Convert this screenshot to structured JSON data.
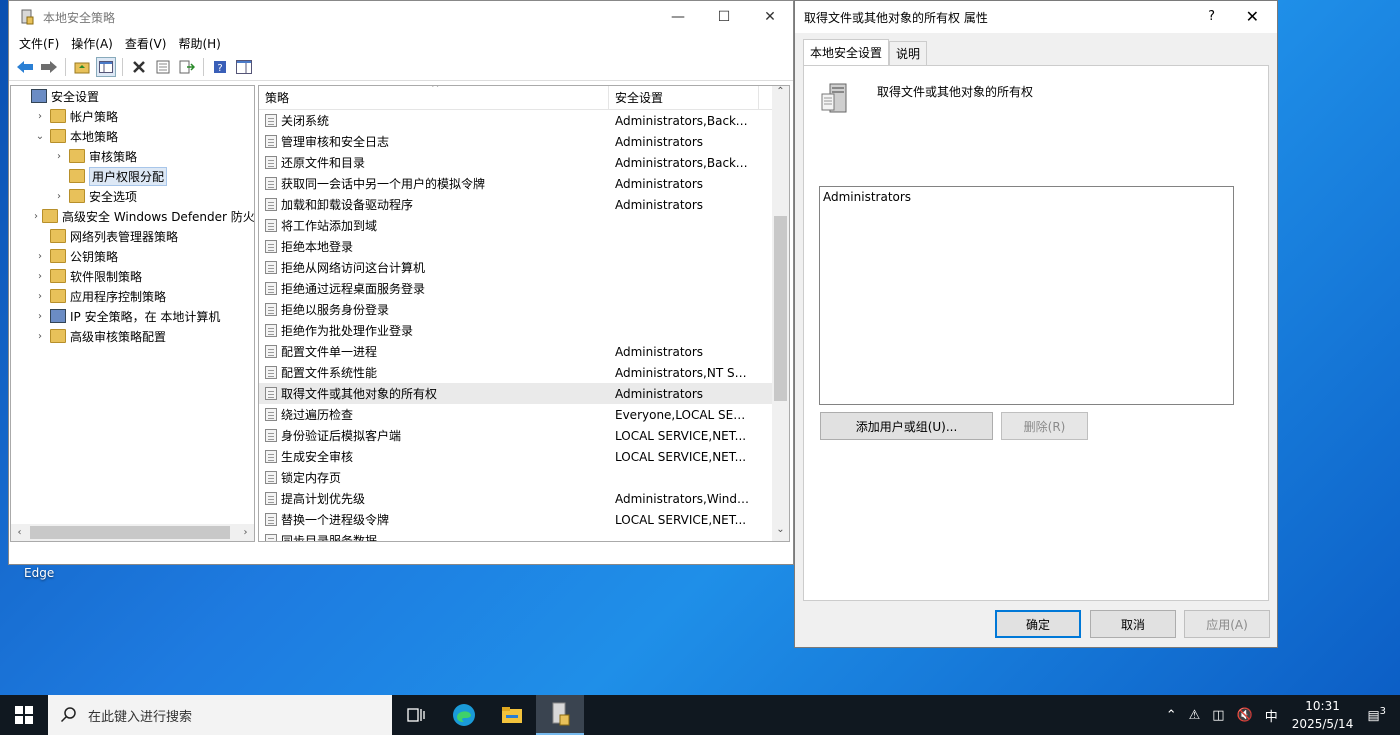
{
  "mmc": {
    "title": "本地安全策略",
    "menu": [
      "文件(F)",
      "操作(A)",
      "查看(V)",
      "帮助(H)"
    ],
    "tree": [
      {
        "label": "安全设置",
        "level": 0,
        "expander": "",
        "icon": "security-settings-icon"
      },
      {
        "label": "帐户策略",
        "level": 1,
        "expander": "›",
        "icon": "folder-icon"
      },
      {
        "label": "本地策略",
        "level": 1,
        "expander": "⌄",
        "icon": "folder-icon"
      },
      {
        "label": "审核策略",
        "level": 2,
        "expander": "›",
        "icon": "folder-icon"
      },
      {
        "label": "用户权限分配",
        "level": 2,
        "expander": "",
        "icon": "folder-icon",
        "selected": true
      },
      {
        "label": "安全选项",
        "level": 2,
        "expander": "›",
        "icon": "folder-icon"
      },
      {
        "label": "高级安全 Windows Defender 防火墙",
        "level": 1,
        "expander": "›",
        "icon": "folder-icon"
      },
      {
        "label": "网络列表管理器策略",
        "level": 1,
        "expander": "",
        "icon": "folder-icon"
      },
      {
        "label": "公钥策略",
        "level": 1,
        "expander": "›",
        "icon": "folder-icon"
      },
      {
        "label": "软件限制策略",
        "level": 1,
        "expander": "›",
        "icon": "folder-icon"
      },
      {
        "label": "应用程序控制策略",
        "level": 1,
        "expander": "›",
        "icon": "folder-icon"
      },
      {
        "label": "IP 安全策略，在 本地计算机",
        "level": 1,
        "expander": "›",
        "icon": "ip-security-icon"
      },
      {
        "label": "高级审核策略配置",
        "level": 1,
        "expander": "›",
        "icon": "folder-icon"
      }
    ],
    "columns": {
      "policy": "策略",
      "setting": "安全设置"
    },
    "rows": [
      {
        "policy": "关闭系统",
        "setting": "Administrators,Backu..."
      },
      {
        "policy": "管理审核和安全日志",
        "setting": "Administrators"
      },
      {
        "policy": "还原文件和目录",
        "setting": "Administrators,Backu..."
      },
      {
        "policy": "获取同一会话中另一个用户的模拟令牌",
        "setting": "Administrators"
      },
      {
        "policy": "加载和卸载设备驱动程序",
        "setting": "Administrators"
      },
      {
        "policy": "将工作站添加到域",
        "setting": ""
      },
      {
        "policy": "拒绝本地登录",
        "setting": ""
      },
      {
        "policy": "拒绝从网络访问这台计算机",
        "setting": ""
      },
      {
        "policy": "拒绝通过远程桌面服务登录",
        "setting": ""
      },
      {
        "policy": "拒绝以服务身份登录",
        "setting": ""
      },
      {
        "policy": "拒绝作为批处理作业登录",
        "setting": ""
      },
      {
        "policy": "配置文件单一进程",
        "setting": "Administrators"
      },
      {
        "policy": "配置文件系统性能",
        "setting": "Administrators,NT SE..."
      },
      {
        "policy": "取得文件或其他对象的所有权",
        "setting": "Administrators",
        "selected": true
      },
      {
        "policy": "绕过遍历检查",
        "setting": "Everyone,LOCAL SERV..."
      },
      {
        "policy": "身份验证后模拟客户端",
        "setting": "LOCAL SERVICE,NET..."
      },
      {
        "policy": "生成安全审核",
        "setting": "LOCAL SERVICE,NET..."
      },
      {
        "policy": "锁定内存页",
        "setting": ""
      },
      {
        "policy": "提高计划优先级",
        "setting": "Administrators,Windo..."
      },
      {
        "policy": "替换一个进程级令牌",
        "setting": "LOCAL SERVICE,NET..."
      },
      {
        "policy": "同步目录服务数据",
        "setting": ""
      }
    ]
  },
  "desktop": {
    "edge_label": "Edge"
  },
  "dialog": {
    "title": "取得文件或其他对象的所有权 属性",
    "help": "?",
    "tabs": [
      "本地安全设置",
      "说明"
    ],
    "policy_name": "取得文件或其他对象的所有权",
    "members": [
      "Administrators"
    ],
    "add_button": "添加用户或组(U)...",
    "remove_button": "删除(R)",
    "ok_button": "确定",
    "cancel_button": "取消",
    "apply_button": "应用(A)"
  },
  "taskbar": {
    "search_placeholder": "在此键入进行搜索",
    "ime": "中",
    "time": "10:31",
    "date": "2025/5/14",
    "notification_count": "3"
  }
}
